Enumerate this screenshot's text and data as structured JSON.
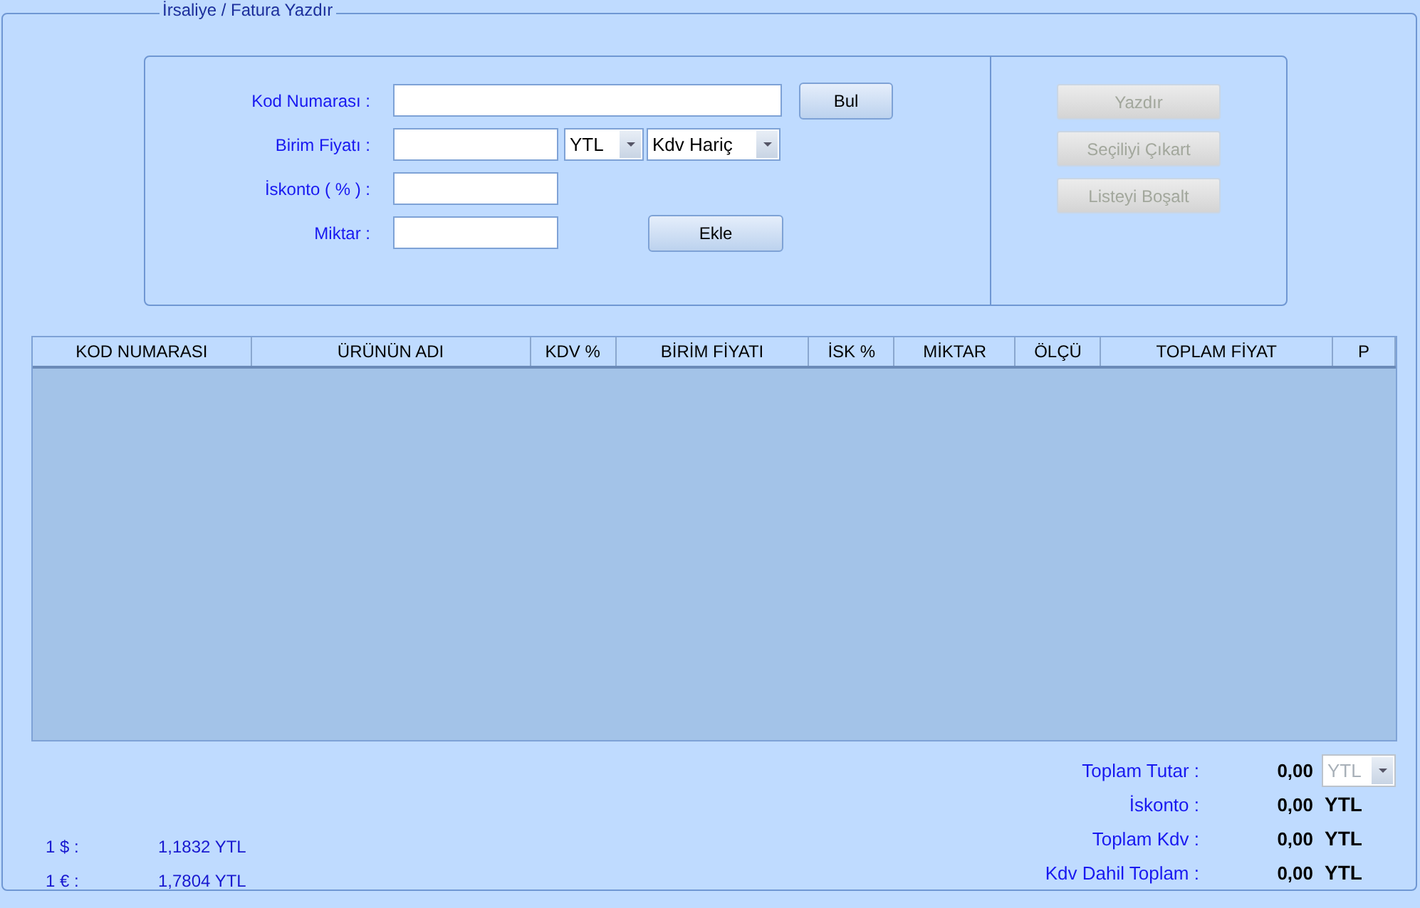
{
  "group_title": "İrsaliye / Fatura Yazdır",
  "form": {
    "code_label": "Kod Numarası  :",
    "find_button": "Bul",
    "price_label": "Birim Fiyatı  :",
    "currency": {
      "value": "YTL",
      "disabled": false
    },
    "tax_mode": {
      "value": "Kdv Hariç",
      "disabled": false
    },
    "discount_label": "İskonto ( % )  :",
    "quantity_label": "Miktar  :",
    "add_button": "Ekle"
  },
  "actions": [
    {
      "label": "Yazdır",
      "disabled": true
    },
    {
      "label": "Seçiliyi Çıkart",
      "disabled": true
    },
    {
      "label": "Listeyi Boşalt",
      "disabled": true
    }
  ],
  "table": {
    "columns": [
      "KOD NUMARASI",
      "ÜRÜNÜN ADI",
      "KDV %",
      "BİRİM FİYATI",
      "İSK %",
      "MİKTAR",
      "ÖLÇÜ",
      "TOPLAM FİYAT",
      "P"
    ]
  },
  "rates": [
    {
      "label": "1 $  :",
      "value": "1,1832 YTL"
    },
    {
      "label": "1 €  :",
      "value": "1,7804 YTL"
    }
  ],
  "totals": [
    {
      "label": "Toplam Tutar  :",
      "value": "0,00",
      "kind": "select",
      "unit": "YTL",
      "disabled": true
    },
    {
      "label": "İskonto  :",
      "value": "0,00",
      "kind": "text",
      "unit": "YTL"
    },
    {
      "label": "Toplam Kdv  :",
      "value": "0,00",
      "kind": "text",
      "unit": "YTL"
    },
    {
      "label": "Kdv Dahil Toplam  :",
      "value": "0,00",
      "kind": "text",
      "unit": "YTL"
    }
  ]
}
